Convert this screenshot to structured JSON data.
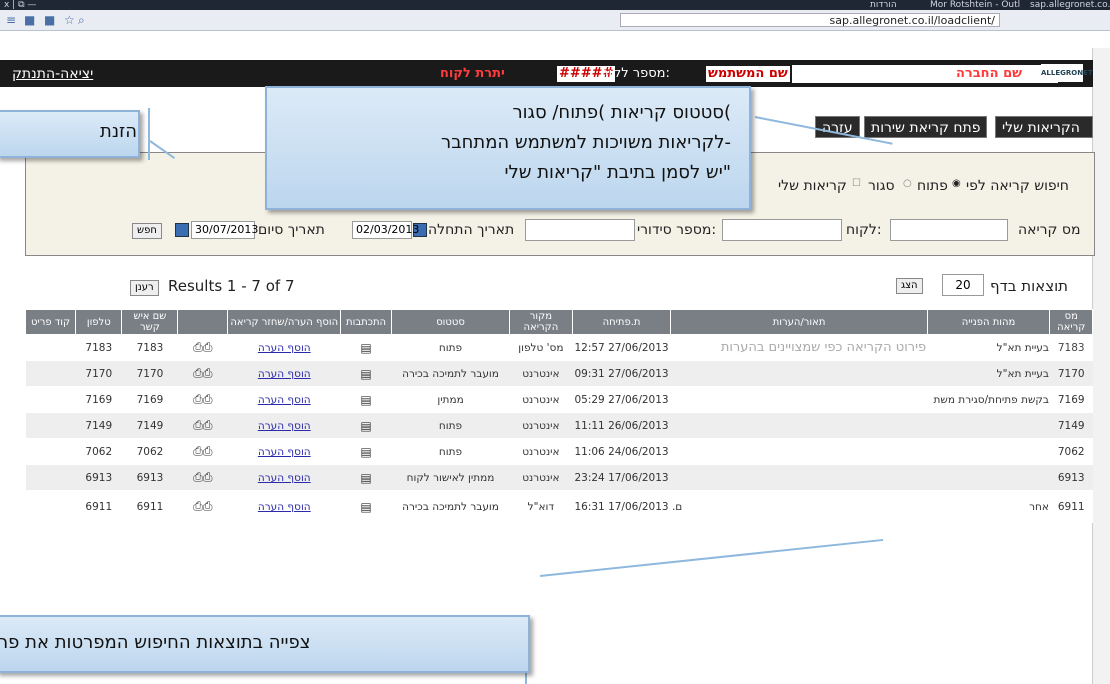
{
  "browser": {
    "tabs": [
      {
        "label": "הורדות"
      },
      {
        "label": "Mor Rotshtein - Outl"
      },
      {
        "label": "sap.allegronet.co.il/lo"
      }
    ],
    "url": "sap.allegronet.co.il/loadclient/"
  },
  "header": {
    "logout": "יציאה-התנתק",
    "company_label": "שם החברה",
    "user_label": "שם המשתמש",
    "client_number_label": "מספר לקוח:",
    "client_number_value": "#####",
    "balance_label": "יתרת לקוח",
    "logo": "ALLEGRONET"
  },
  "nav": {
    "my_calls": "הקריאות שלי",
    "open_service_call": "פתח קריאת שירות",
    "help": "עזרה"
  },
  "search": {
    "search_by_label": "חיפוש קריאה לפי",
    "open_label": "פתוח",
    "closed_label": "סגור",
    "my_calls_label": "קריאות שלי",
    "call_no_label": "מס קריאה",
    "client_label": "לקוח:",
    "serial_label": "מספר סידורי:",
    "start_date_label": "תאריך התחלה",
    "start_date_value": "02/03/2013",
    "end_date_label": "תאריך סיום",
    "end_date_value": "30/07/2013",
    "search_button": "חפש"
  },
  "results": {
    "per_page_label": "תוצאות בדף",
    "per_page_value": "20",
    "show_button": "הצג",
    "summary": "Results 1 - 7 of 7",
    "refresh_button": "רענן"
  },
  "table": {
    "headers": [
      "מס קריאה",
      "מהות הפנייה",
      "תאור/הערות",
      "ת.פתיחה",
      "מקור הקריאה",
      "סטטוס",
      "התכתבות",
      "הוסף הערה/שחזר קריאה",
      "",
      "שם איש קשר",
      "טלפון",
      "קוד פריט"
    ],
    "add_note": "הוסף הערה",
    "rows": [
      {
        "id": "7183",
        "subject": "בעיית תא\"ל",
        "desc": "פירוט הקריאה כפי שמצויינים בהערות",
        "opened": "27/06/2013 12:57",
        "source": "מס' טלפון",
        "status": "פתוח",
        "contact": "7183",
        "phone": "7183"
      },
      {
        "id": "7170",
        "subject": "בעיית תא\"ל",
        "desc": "",
        "opened": "27/06/2013 09:31",
        "source": "אינטרנט",
        "status": "מועבר לתמיכה בכירה",
        "contact": "7170",
        "phone": "7170"
      },
      {
        "id": "7169",
        "subject": "בקשת פתיחת/סגירת משת",
        "desc": "",
        "opened": "27/06/2013 05:29",
        "source": "אינטרנט",
        "status": "ממתין",
        "contact": "7169",
        "phone": "7169"
      },
      {
        "id": "7149",
        "subject": "",
        "desc": "",
        "opened": "26/06/2013 11:11",
        "source": "אינטרנט",
        "status": "פתוח",
        "contact": "7149",
        "phone": "7149"
      },
      {
        "id": "7062",
        "subject": "",
        "desc": "",
        "opened": "24/06/2013 11:06",
        "source": "אינטרנט",
        "status": "פתוח",
        "contact": "7062",
        "phone": "7062"
      },
      {
        "id": "6913",
        "subject": "",
        "desc": "",
        "opened": "17/06/2013 23:24",
        "source": "אינטרנט",
        "status": "ממתין לאישור לקוח",
        "contact": "6913",
        "phone": "6913"
      },
      {
        "id": "6911",
        "subject": "אחר",
        "desc": "ם.",
        "opened": "17/06/2013 16:31",
        "source": "דוא\"ל",
        "status": "מועבר לתמיכה בכירה",
        "contact": "6911",
        "phone": "6911"
      }
    ]
  },
  "callouts": {
    "status": [
      "סטטוס קריאות )פתוח/ סגור(",
      "לקריאות משויכות למשתמש המתחבר-",
      "יש לסמן בתיבת \"קריאות שלי\""
    ],
    "logout_hint": "הזנת ה",
    "results_hint": "צפייה בתוצאות החיפוש המפרטות את פר"
  }
}
